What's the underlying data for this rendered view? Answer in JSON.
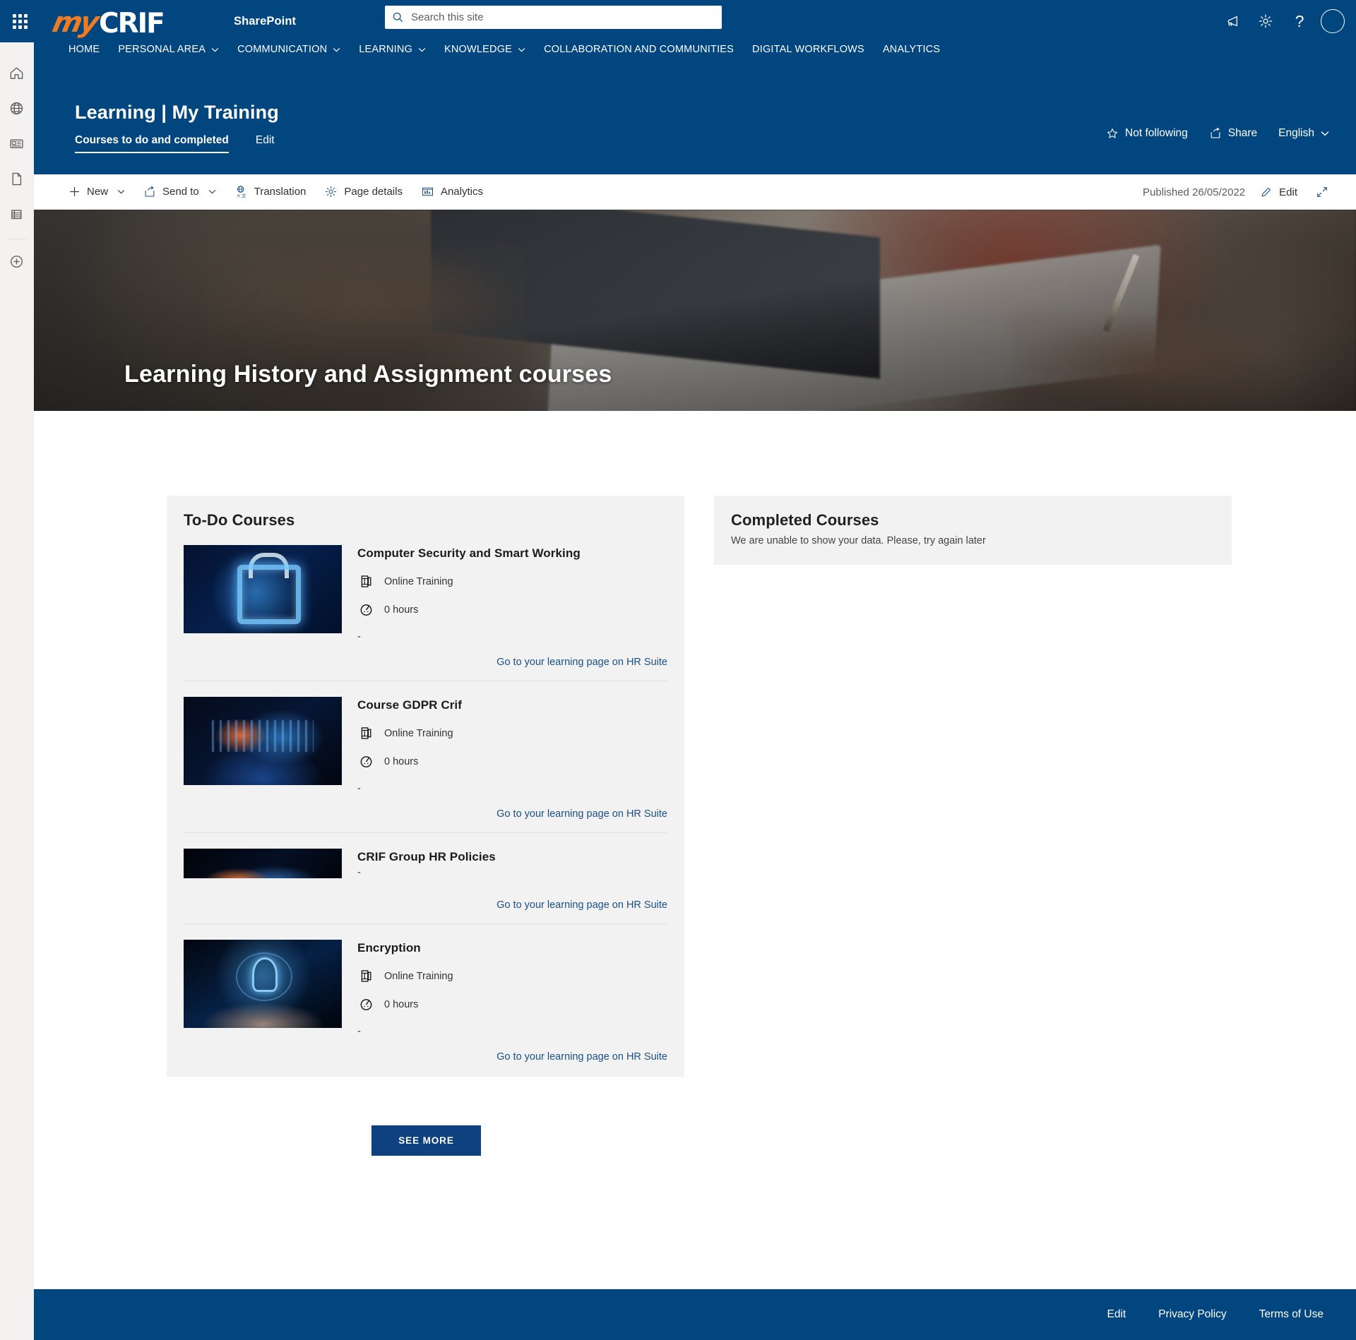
{
  "suitebar": {
    "waffle_label": "App launcher",
    "logo_my": "my",
    "logo_crif": "CRIF",
    "app_name": "SharePoint",
    "icons": [
      "megaphone-icon",
      "gear-icon",
      "help-icon",
      "avatar"
    ]
  },
  "search": {
    "placeholder": "Search this site",
    "value": ""
  },
  "leftrail": {
    "items": [
      {
        "name": "home-icon"
      },
      {
        "name": "globe-icon"
      },
      {
        "name": "news-icon"
      },
      {
        "name": "document-icon"
      },
      {
        "name": "pages-icon"
      },
      {
        "name": "add-icon"
      }
    ]
  },
  "nav": {
    "items": [
      {
        "label": "HOME",
        "has_chevron": false
      },
      {
        "label": "PERSONAL AREA",
        "has_chevron": true
      },
      {
        "label": "COMMUNICATION",
        "has_chevron": true
      },
      {
        "label": "LEARNING",
        "has_chevron": true
      },
      {
        "label": "KNOWLEDGE",
        "has_chevron": true
      },
      {
        "label": "COLLABORATION AND COMMUNITIES",
        "has_chevron": false
      },
      {
        "label": "DIGITAL WORKFLOWS",
        "has_chevron": false
      },
      {
        "label": "ANALYTICS",
        "has_chevron": false
      }
    ]
  },
  "page_header": {
    "title": "Learning | My Training",
    "tabs": [
      {
        "label": "Courses to do and completed",
        "active": true
      },
      {
        "label": "Edit",
        "active": false
      }
    ],
    "follow_label": "Not following",
    "share_label": "Share",
    "language_label": "English"
  },
  "commandbar": {
    "new_label": "New",
    "send_to_label": "Send to",
    "translation_label": "Translation",
    "page_details_label": "Page details",
    "analytics_label": "Analytics",
    "published_label": "Published 26/05/2022",
    "edit_label": "Edit",
    "expand_label": "Full screen"
  },
  "hero": {
    "title": "Learning History and Assignment courses"
  },
  "todo_panel": {
    "heading": "To-Do Courses",
    "link_label": "Go to your learning page on HR Suite",
    "dash": "-",
    "courses": [
      {
        "title": "Computer Security and Smart Working",
        "mode": "Online Training",
        "duration": "0 hours",
        "thumb": "lock-thumbnail",
        "dash": "-",
        "link": "Go to your learning page on HR Suite"
      },
      {
        "title": "Course GDPR Crif",
        "mode": "Online Training",
        "duration": "0 hours",
        "thumb": "data-analytics-thumbnail",
        "dash": "-",
        "link": "Go to your learning page on HR Suite"
      },
      {
        "title": "CRIF Group HR Policies",
        "mode": "",
        "duration": "",
        "thumb": "hr-policies-thumbnail",
        "dash": "-",
        "link": "Go to your learning page on HR Suite"
      },
      {
        "title": "Encryption",
        "mode": "Online Training",
        "duration": "0 hours",
        "thumb": "rocket-thumbnail",
        "dash": "-",
        "link": "Go to your learning page on HR Suite"
      }
    ],
    "see_more_label": "SEE MORE"
  },
  "completed_panel": {
    "heading": "Completed Courses",
    "message": "We are unable to show your data. Please, try again later"
  },
  "footer": {
    "links": [
      "Edit",
      "Privacy Policy",
      "Terms of Use"
    ]
  },
  "colors": {
    "brand_blue": "#01467f",
    "brand_orange": "#ef7c23",
    "panel_gray": "#f2f2f2",
    "link_blue": "#1b5087",
    "button_blue": "#0f4181"
  }
}
